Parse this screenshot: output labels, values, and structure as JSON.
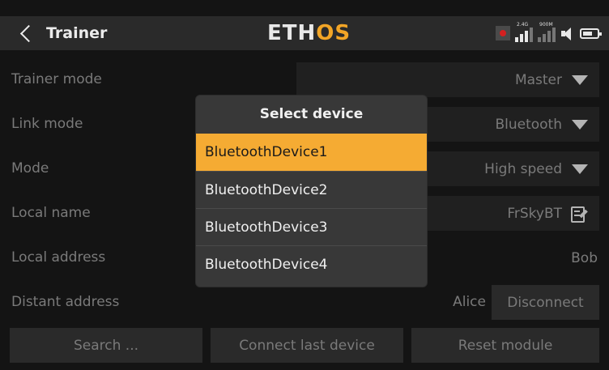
{
  "header": {
    "title": "Trainer",
    "logo_left": "ETH",
    "logo_right": "OS",
    "signal1_label": "2.4G",
    "signal2_label": "900M",
    "icons": [
      "back-icon",
      "record-icon",
      "signal-24g-icon",
      "signal-900m-icon",
      "speaker-icon",
      "battery-icon"
    ]
  },
  "rows": {
    "trainer_mode": {
      "label": "Trainer mode",
      "value": "Master"
    },
    "link_mode": {
      "label": "Link mode",
      "value": "Bluetooth"
    },
    "mode": {
      "label": "Mode",
      "value": "High speed"
    },
    "local_name": {
      "label": "Local name",
      "value": "FrSkyBT"
    },
    "local_address": {
      "label": "Local address",
      "value": "Bob"
    },
    "distant_address": {
      "label": "Distant address",
      "value": "Alice",
      "button": "Disconnect"
    }
  },
  "buttons": {
    "search": "Search ...",
    "connect_last": "Connect last device",
    "reset_module": "Reset module"
  },
  "dialog": {
    "title": "Select device",
    "items": [
      "BluetoothDevice1",
      "BluetoothDevice2",
      "BluetoothDevice3",
      "BluetoothDevice4"
    ],
    "selected_index": 0
  },
  "colors": {
    "accent": "#f5ab33",
    "background": "#141414",
    "header": "#2a2a2a",
    "dialog": "#383838"
  }
}
